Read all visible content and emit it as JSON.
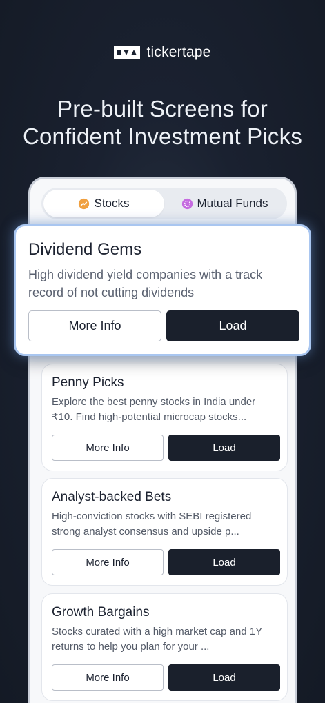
{
  "brand": {
    "name": "tickertape",
    "logo_icon": "tickertape-logo-icon"
  },
  "headline": {
    "line1": "Pre-built Screens for",
    "line2": "Confident Investment Picks"
  },
  "tabs": [
    {
      "label": "Stocks",
      "icon": "stocks-icon",
      "active": true,
      "color": "#f0a040"
    },
    {
      "label": "Mutual Funds",
      "icon": "mutual-funds-icon",
      "active": false,
      "color": "#c56be0"
    }
  ],
  "featured": {
    "title": "Dividend Gems",
    "description": "High dividend yield companies with a track record of not cutting dividends",
    "more_info_label": "More Info",
    "load_label": "Load"
  },
  "screens": [
    {
      "title": "Penny Picks",
      "description": "Explore the best penny stocks in India under ₹10. Find high-potential microcap stocks...",
      "more_info_label": "More Info",
      "load_label": "Load"
    },
    {
      "title": "Analyst-backed Bets",
      "description": "High-conviction stocks with SEBI registered strong analyst consensus and upside p...",
      "more_info_label": "More Info",
      "load_label": "Load"
    },
    {
      "title": "Growth Bargains",
      "description": "Stocks curated with a high market cap and 1Y returns to help you plan for your ...",
      "more_info_label": "More Info",
      "load_label": "Load"
    }
  ],
  "colors": {
    "background": "#1a2130",
    "accent_glow": "#a9c6f0",
    "dark_button": "#1a202c"
  }
}
